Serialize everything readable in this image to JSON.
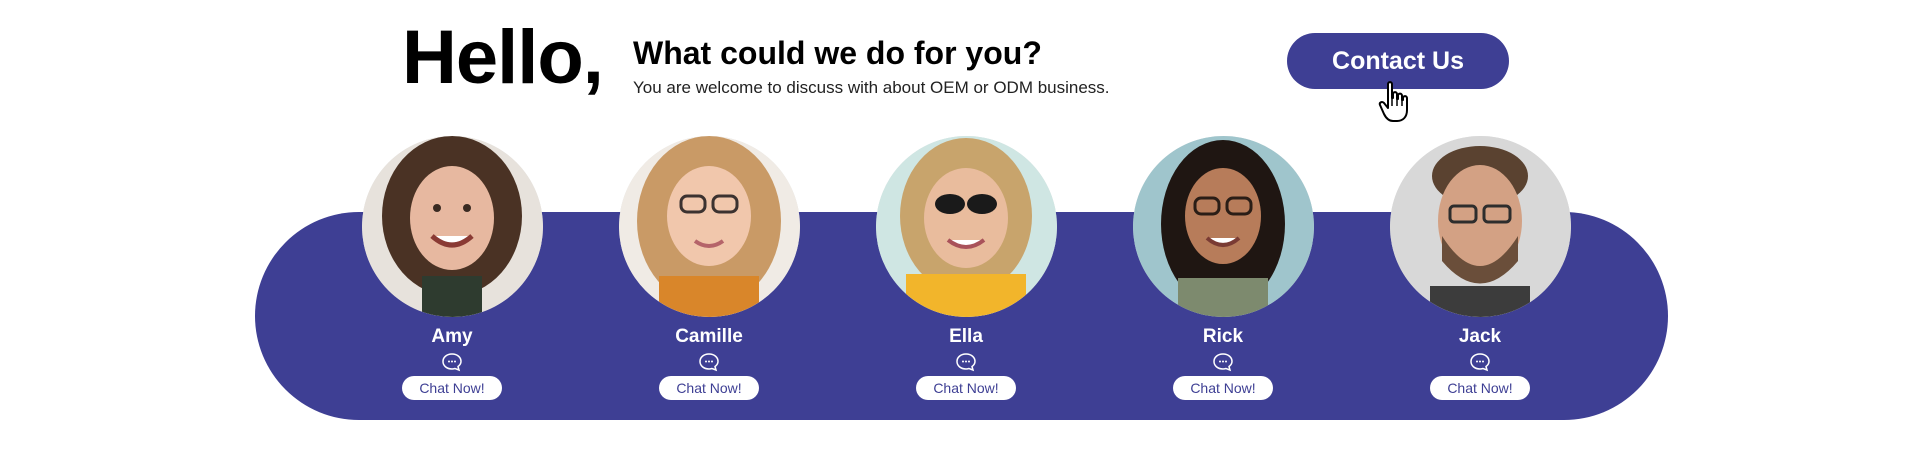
{
  "header": {
    "greeting": "Hello,",
    "headline": "What could we do for you?",
    "subline": "You are welcome to discuss with about OEM or ODM business.",
    "contact_label": "Contact Us"
  },
  "colors": {
    "brand": "#3e3f94",
    "text": "#000000",
    "button_text_on_white": "#3e3f94"
  },
  "team": [
    {
      "name": "Amy",
      "chat_label": "Chat Now!",
      "icon": "chat-bubble-icon"
    },
    {
      "name": "Camille",
      "chat_label": "Chat Now!",
      "icon": "chat-bubble-icon"
    },
    {
      "name": "Ella",
      "chat_label": "Chat Now!",
      "icon": "chat-bubble-icon"
    },
    {
      "name": "Rick",
      "chat_label": "Chat Now!",
      "icon": "chat-bubble-icon"
    },
    {
      "name": "Jack",
      "chat_label": "Chat Now!",
      "icon": "chat-bubble-icon"
    }
  ]
}
